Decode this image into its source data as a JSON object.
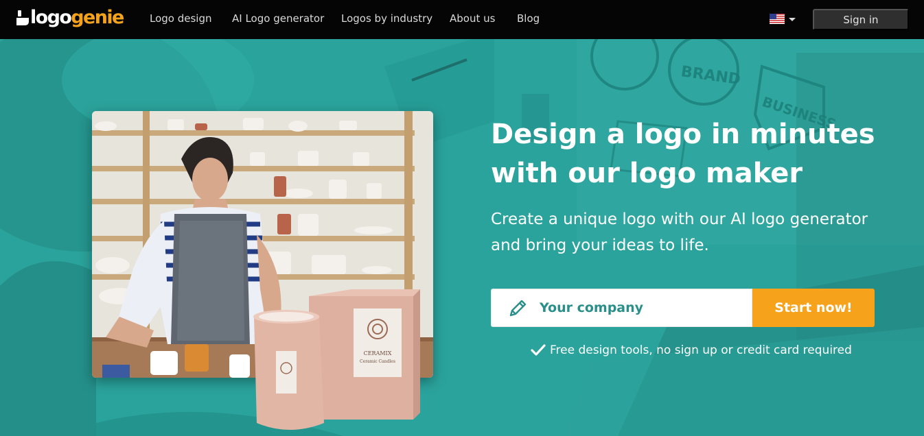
{
  "brand": {
    "name_part1": "logo",
    "name_part2": "genie",
    "accent": "#f5a31a"
  },
  "nav": {
    "links": [
      "Logo design",
      "AI Logo generator",
      "Logos by industry",
      "About us",
      "Blog"
    ],
    "language_icon": "us-flag-icon",
    "signin_label": "Sign in"
  },
  "hero": {
    "headline_line1": "Design a logo in minutes",
    "headline_line2": "with our logo maker",
    "subline_line1": "Create a unique logo with our AI logo generator",
    "subline_line2": "and bring your ideas to life.",
    "input_placeholder": "Your company",
    "cta_label": "Start now!",
    "note": "Free design tools, no sign up or credit card required",
    "background_color": "#2aa39c",
    "cta_color": "#f6a21b"
  },
  "background_words": [
    "BRAND",
    "BUSINESS"
  ],
  "product": {
    "brand": "CERAMIX",
    "subtitle": "Ceramic Candles"
  },
  "icons": [
    "logo-lamp-icon",
    "pencil-icon",
    "checkmark-icon",
    "chevron-down-icon"
  ]
}
